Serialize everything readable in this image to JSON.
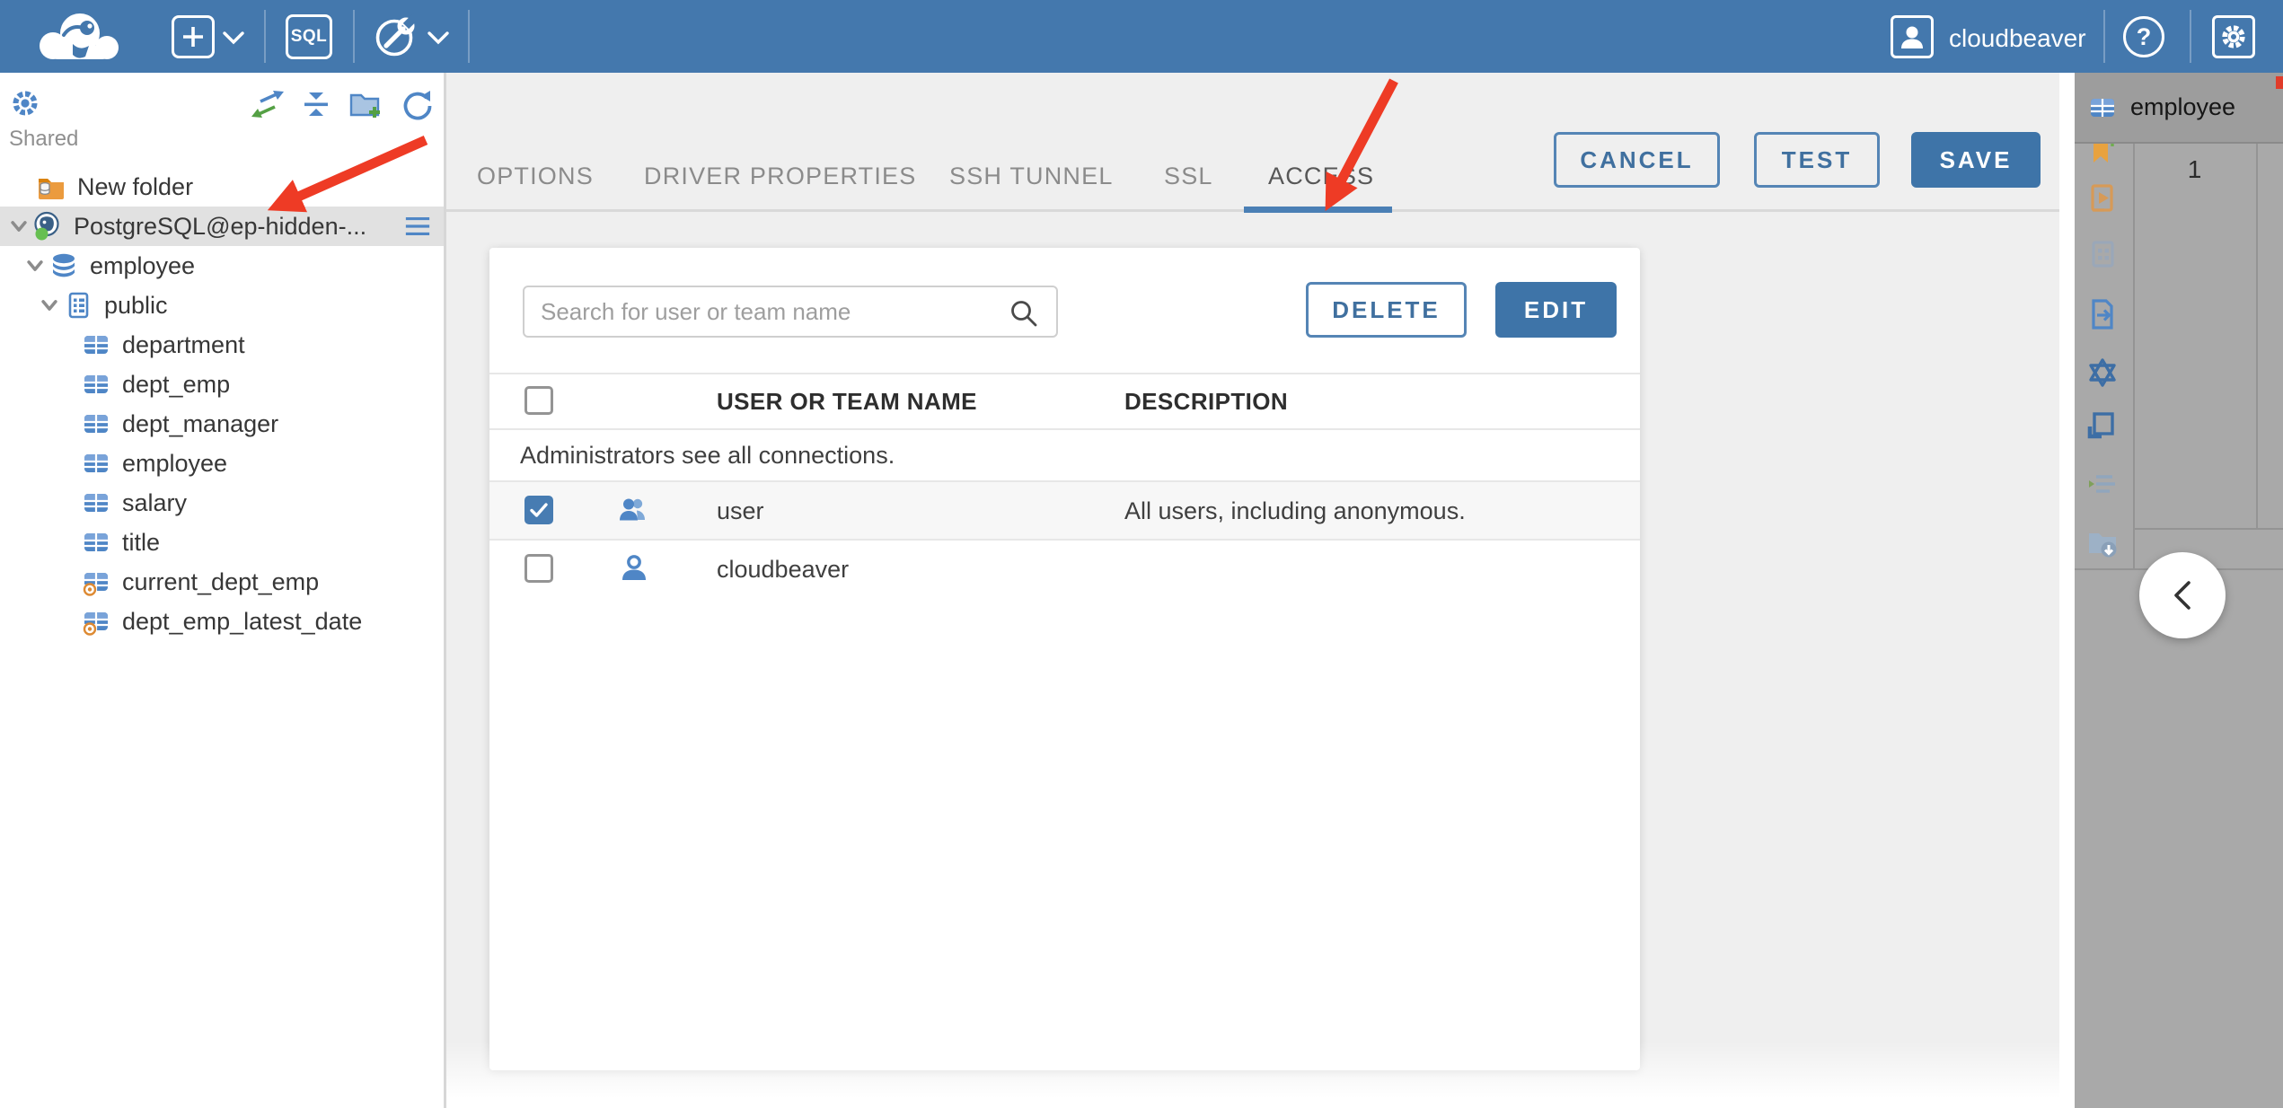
{
  "colors": {
    "topbar_blue": "#4478ad",
    "accent_blue": "#3e74a8",
    "accent_border": "#5585b5",
    "active_tab_underline": "#4a7fb5",
    "tree_selection": "#e1e1e1",
    "main_background": "#efefef",
    "right_panel_gray": "#a9a9a9",
    "icon_blue": "#4f86c6",
    "folder_orange": "#eb9b3e",
    "status_green": "#66bf51",
    "annotation_red": "#ee3b25"
  },
  "topbar": {
    "sql_badge": "SQL",
    "help_glyph": "?",
    "user_label": "cloudbeaver",
    "icons": [
      "cloudbeaver-logo",
      "new-connection-icon",
      "chevron-down-icon",
      "sql-editor-icon",
      "connection-wrench-icon",
      "chevron-down-icon",
      "user-badge-icon",
      "help-icon",
      "settings-gear-icon"
    ]
  },
  "sidebar": {
    "section_label": "Shared",
    "toolbar_icons": [
      "settings-gear-icon",
      "sync-connections-icon",
      "collapse-all-icon",
      "add-folder-icon",
      "refresh-icon"
    ],
    "tree": [
      {
        "label": "New folder",
        "icon": "folder-database",
        "depth": 0
      },
      {
        "label": "PostgreSQL@ep-hidden-...",
        "icon": "postgresql-connection",
        "depth": 0,
        "selected": true,
        "expanded": true,
        "status": "connected"
      },
      {
        "label": "employee",
        "icon": "database",
        "depth": 1,
        "expanded": true
      },
      {
        "label": "public",
        "icon": "schema",
        "depth": 2,
        "expanded": true
      },
      {
        "label": "department",
        "icon": "table",
        "depth": 3
      },
      {
        "label": "dept_emp",
        "icon": "table",
        "depth": 3
      },
      {
        "label": "dept_manager",
        "icon": "table",
        "depth": 3
      },
      {
        "label": "employee",
        "icon": "table",
        "depth": 3
      },
      {
        "label": "salary",
        "icon": "table",
        "depth": 3
      },
      {
        "label": "title",
        "icon": "table",
        "depth": 3
      },
      {
        "label": "current_dept_emp",
        "icon": "view",
        "depth": 3
      },
      {
        "label": "dept_emp_latest_date",
        "icon": "view",
        "depth": 3
      }
    ]
  },
  "main": {
    "tabs": [
      {
        "label": "OPTIONS",
        "active": false
      },
      {
        "label": "DRIVER PROPERTIES",
        "active": false
      },
      {
        "label": "SSH TUNNEL",
        "active": false
      },
      {
        "label": "SSL",
        "active": false
      },
      {
        "label": "ACCESS",
        "active": true
      }
    ],
    "actions": {
      "cancel": "CANCEL",
      "test": "TEST",
      "save": "SAVE"
    },
    "access": {
      "search_placeholder": "Search for user or team name",
      "delete_label": "DELETE",
      "edit_label": "EDIT",
      "note": "Administrators see all connections.",
      "columns": [
        "USER OR TEAM NAME",
        "DESCRIPTION"
      ],
      "rows": [
        {
          "checked": true,
          "icon": "team",
          "name": "user",
          "description": "All users, including anonymous."
        },
        {
          "checked": false,
          "icon": "user",
          "name": "cloudbeaver",
          "description": ""
        }
      ]
    }
  },
  "right_panel": {
    "tab_label": "employee",
    "tab_icon": "table",
    "row_number": "1",
    "tool_icons": [
      "bookmark-add-icon",
      "execute-script-icon",
      "grid-view-icon",
      "export-data-icon",
      "ai-assistant-icon",
      "value-panel-icon",
      "filters-icon",
      "save-to-folder-icon"
    ],
    "collapse_button": "chevron-left"
  },
  "annotations": {
    "arrow_color": "#ee3b25",
    "arrows": [
      "points-to-postgresql-connection",
      "points-to-access-tab"
    ]
  }
}
